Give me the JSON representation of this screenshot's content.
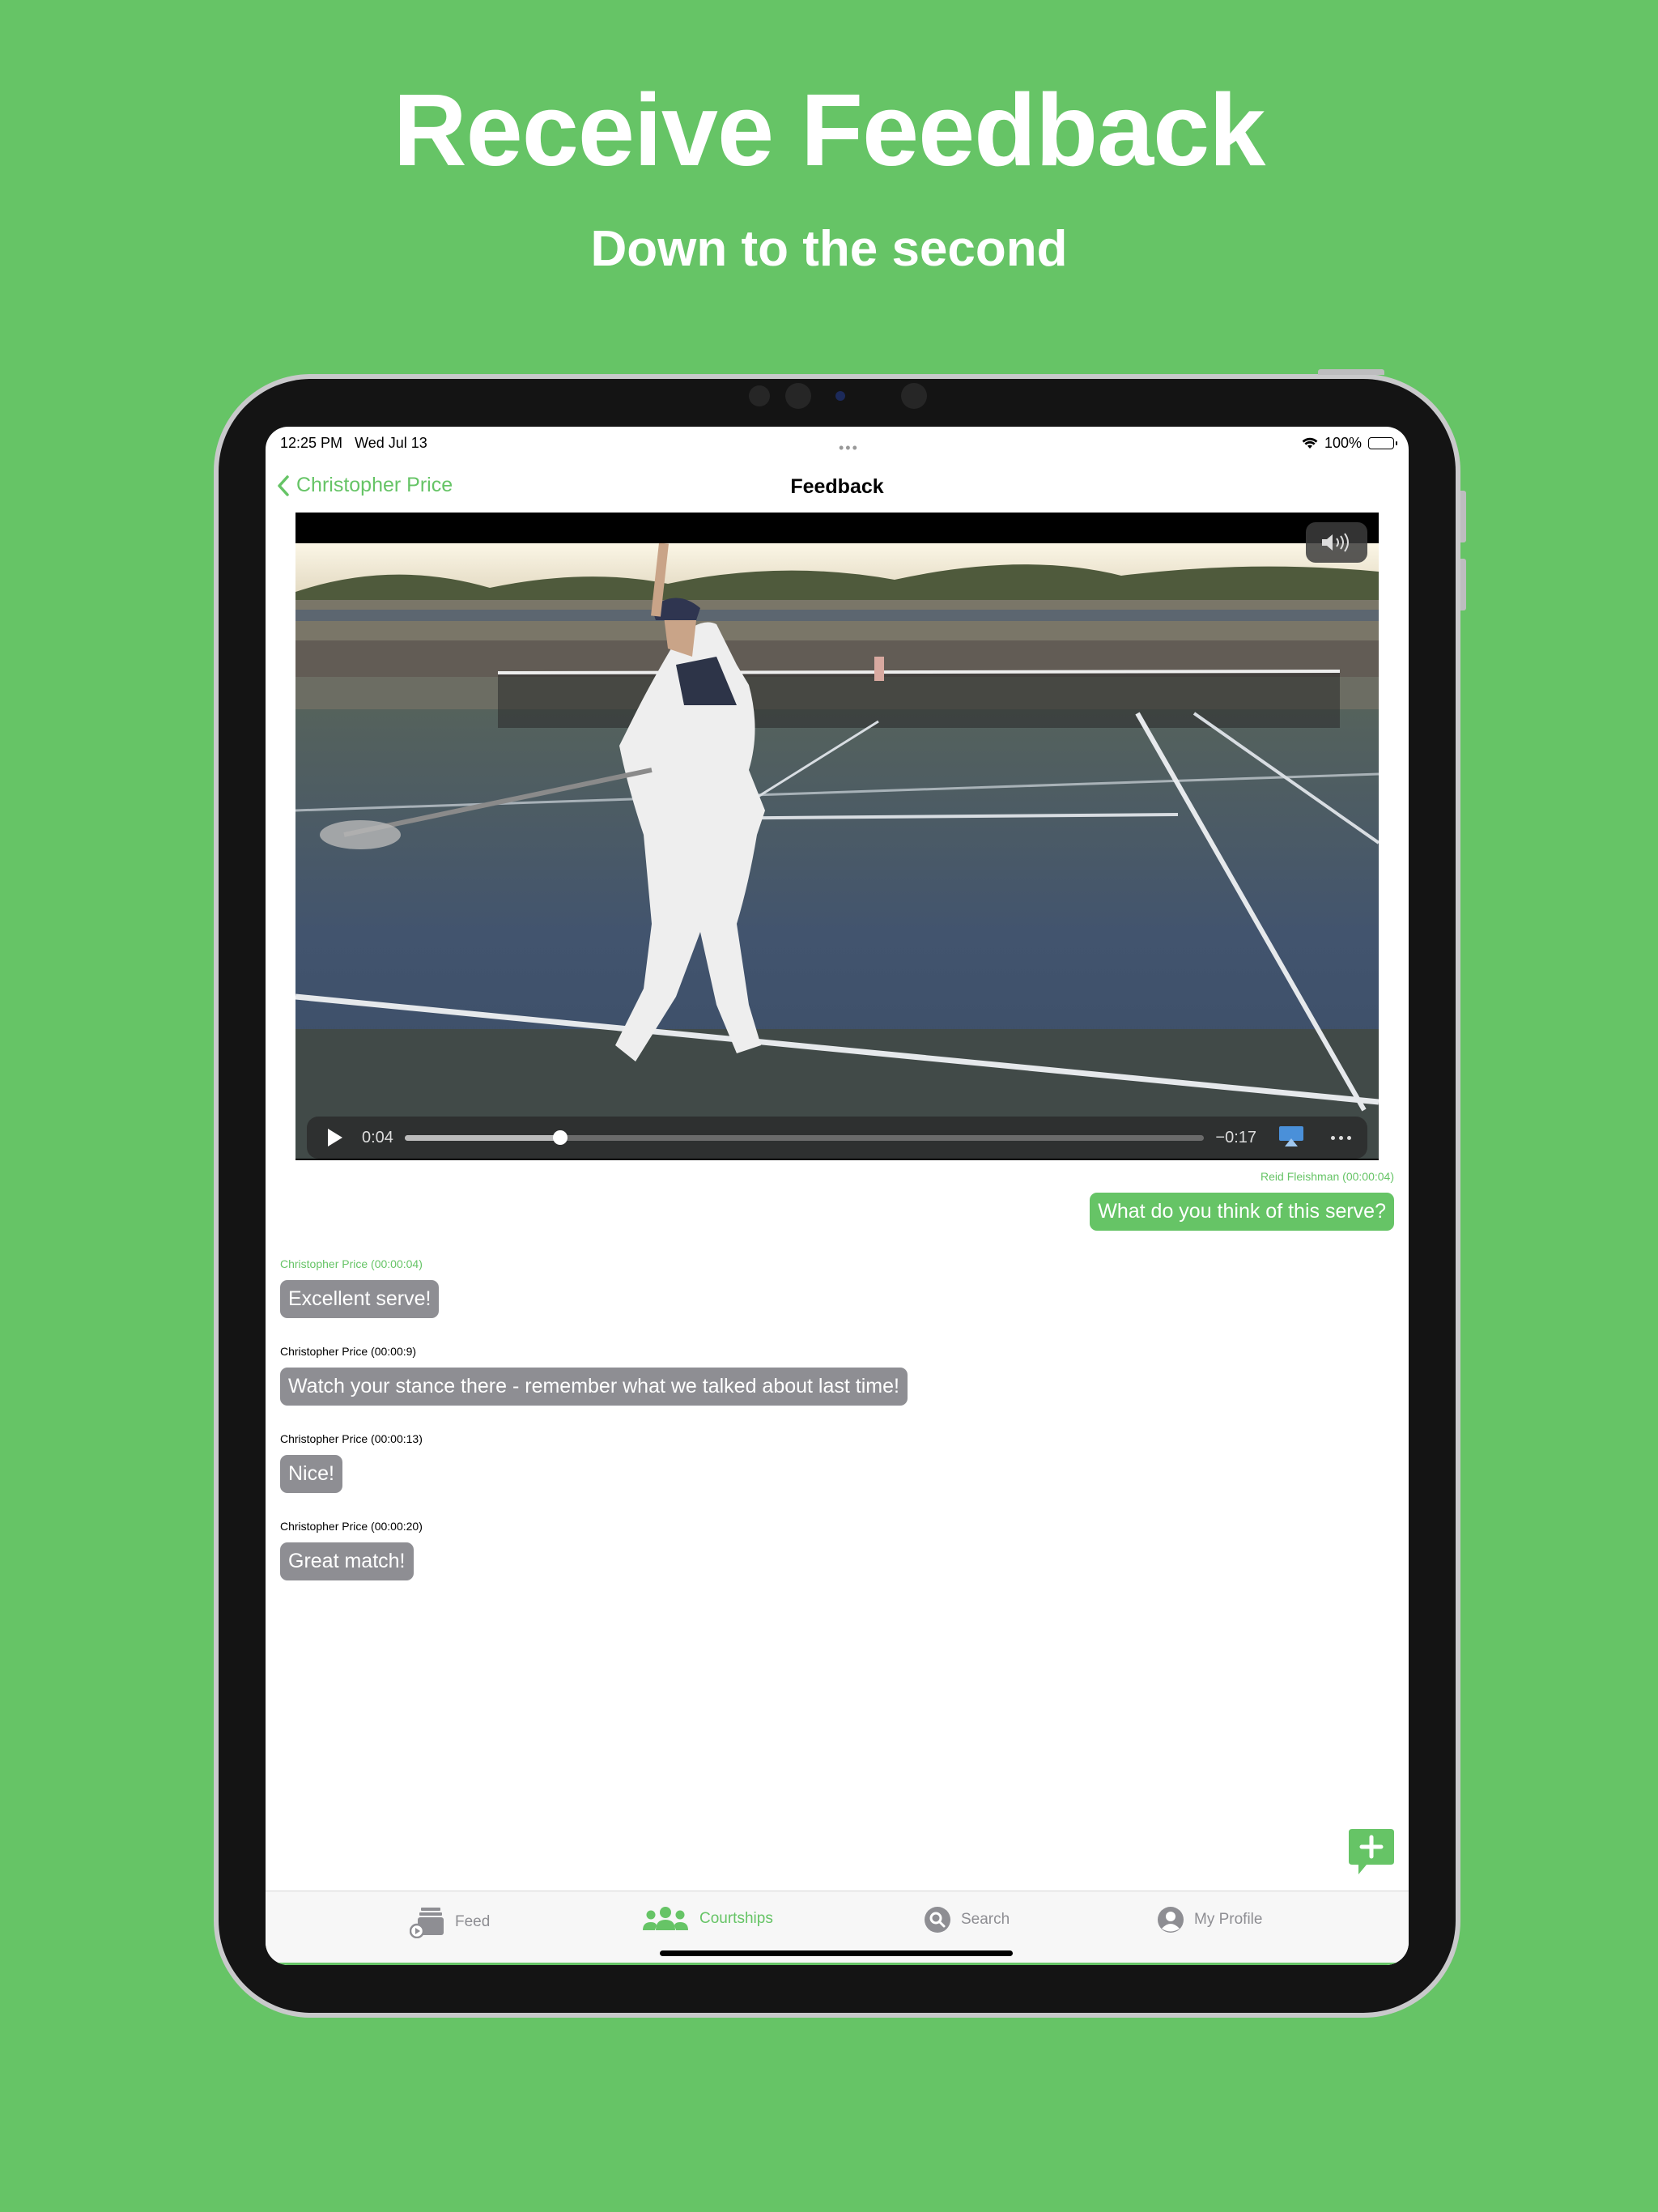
{
  "headline": "Receive Feedback",
  "subheadline": "Down to the second",
  "status_bar": {
    "time": "12:25 PM",
    "date": "Wed Jul 13",
    "battery": "100%"
  },
  "nav": {
    "back_label": "Christopher Price",
    "title": "Feedback"
  },
  "video": {
    "current_time": "0:04",
    "remaining_time": "−0:17",
    "progress_fraction": 0.195
  },
  "messages": [
    {
      "meta": "Reid Fleishman (00:00:04)",
      "text": "What do you think of this serve?"
    },
    {
      "meta": "Christopher Price (00:00:04)",
      "text": "Excellent serve!"
    },
    {
      "meta": "Christopher Price (00:00:9)",
      "text": "Watch your stance there - remember what we talked about last time!"
    },
    {
      "meta": "Christopher Price (00:00:13)",
      "text": "Nice!"
    },
    {
      "meta": "Christopher Price (00:00:20)",
      "text": "Great match!"
    }
  ],
  "tabs": [
    {
      "label": "Feed",
      "icon": "feed-icon"
    },
    {
      "label": "Courtships",
      "icon": "people-icon"
    },
    {
      "label": "Search",
      "icon": "search-icon"
    },
    {
      "label": "My Profile",
      "icon": "profile-icon"
    }
  ],
  "colors": {
    "accent": "#66c466",
    "incoming_bubble": "#8e8e93",
    "background": "#66c466"
  }
}
